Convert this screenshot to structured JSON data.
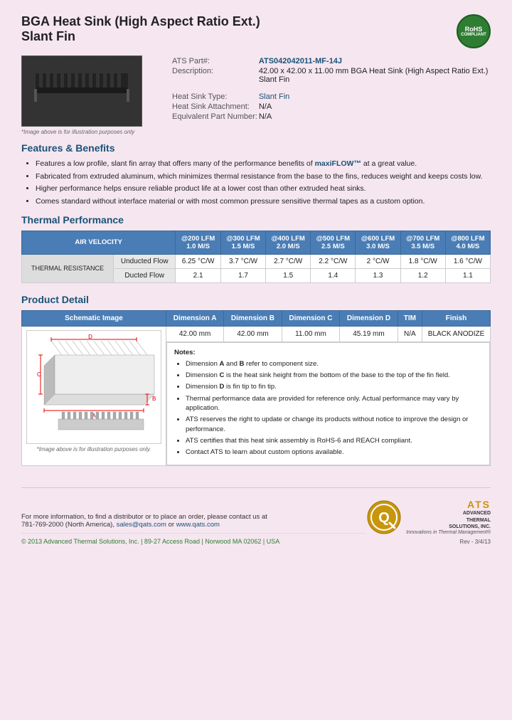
{
  "header": {
    "title_line1": "BGA Heat Sink (High Aspect Ratio Ext.)",
    "title_line2": "Slant Fin",
    "rohs_line1": "RoHS",
    "rohs_line2": "COMPLIANT"
  },
  "product_info": {
    "ats_part_label": "ATS Part#:",
    "ats_part_value": "ATS042042011-MF-14J",
    "description_label": "Description:",
    "description_value": "42.00 x 42.00 x 11.00 mm BGA Heat Sink (High Aspect Ratio Ext.) Slant Fin",
    "heat_sink_type_label": "Heat Sink Type:",
    "heat_sink_type_value": "Slant Fin",
    "attachment_label": "Heat Sink Attachment:",
    "attachment_value": "N/A",
    "equiv_part_label": "Equivalent Part Number:",
    "equiv_part_value": "N/A",
    "image_note": "*Image above is for illustration purposes only"
  },
  "features": {
    "section_title": "Features & Benefits",
    "items": [
      "Features a low profile, slant fin array that offers many of the performance benefits of maxiFLOW™ at a great value.",
      "Fabricated from extruded aluminum, which minimizes thermal resistance from the base to the fins, reduces weight and keeps costs low.",
      "Higher performance helps ensure reliable product life at a lower cost than other extruded heat sinks.",
      "Comes standard without interface material or with most common pressure sensitive thermal tapes as a custom option."
    ],
    "highlight_text": "maxiFLOW™"
  },
  "thermal_performance": {
    "section_title": "Thermal Performance",
    "header_air_velocity": "AIR VELOCITY",
    "columns": [
      {
        "lfm": "@200 LFM",
        "ms": "1.0 M/S"
      },
      {
        "lfm": "@300 LFM",
        "ms": "1.5 M/S"
      },
      {
        "lfm": "@400 LFM",
        "ms": "2.0 M/S"
      },
      {
        "lfm": "@500 LFM",
        "ms": "2.5 M/S"
      },
      {
        "lfm": "@600 LFM",
        "ms": "3.0 M/S"
      },
      {
        "lfm": "@700 LFM",
        "ms": "3.5 M/S"
      },
      {
        "lfm": "@800 LFM",
        "ms": "4.0 M/S"
      }
    ],
    "row_header": "THERMAL RESISTANCE",
    "rows": [
      {
        "label": "Unducted Flow",
        "values": [
          "6.25 °C/W",
          "3.7 °C/W",
          "2.7 °C/W",
          "2.2 °C/W",
          "2 °C/W",
          "1.8 °C/W",
          "1.6 °C/W"
        ]
      },
      {
        "label": "Ducted Flow",
        "values": [
          "2.1",
          "1.7",
          "1.5",
          "1.4",
          "1.3",
          "1.2",
          "1.1"
        ]
      }
    ]
  },
  "product_detail": {
    "section_title": "Product Detail",
    "table_headers": [
      "Schematic Image",
      "Dimension A",
      "Dimension B",
      "Dimension C",
      "Dimension D",
      "TIM",
      "Finish"
    ],
    "dimension_values": [
      "42.00 mm",
      "42.00 mm",
      "11.00 mm",
      "45.19 mm",
      "N/A",
      "BLACK ANODIZE"
    ],
    "schematic_note": "*Image above is for illustration purposes only.",
    "notes_title": "Notes:",
    "notes": [
      "Dimension A and B refer to component size.",
      "Dimension C is the heat sink height from the bottom of the base to the top of the fin field.",
      "Dimension D is fin tip to fin tip.",
      "Thermal performance data are provided for reference only. Actual performance may vary by application.",
      "ATS reserves the right to update or change its products without notice to improve the design or performance.",
      "ATS certifies that this heat sink assembly is RoHS-6 and REACH compliant.",
      "Contact ATS to learn about custom options available."
    ]
  },
  "footer": {
    "contact_text": "For more information, to find a distributor or to place an order, please contact us at",
    "phone": "781-769-2000 (North America),",
    "email": "sales@qats.com",
    "or": "or",
    "website": "www.qats.com",
    "copyright": "© 2013 Advanced Thermal Solutions, Inc.",
    "address": "| 89-27 Access Road | Norwood MA  02062 | USA",
    "tagline": "Innovations in Thermal Management®",
    "ats_brand": "ADVANCED\nTHERMAL\nSOLUTIONS, INC.",
    "rev": "Rev - 3/4/13"
  }
}
